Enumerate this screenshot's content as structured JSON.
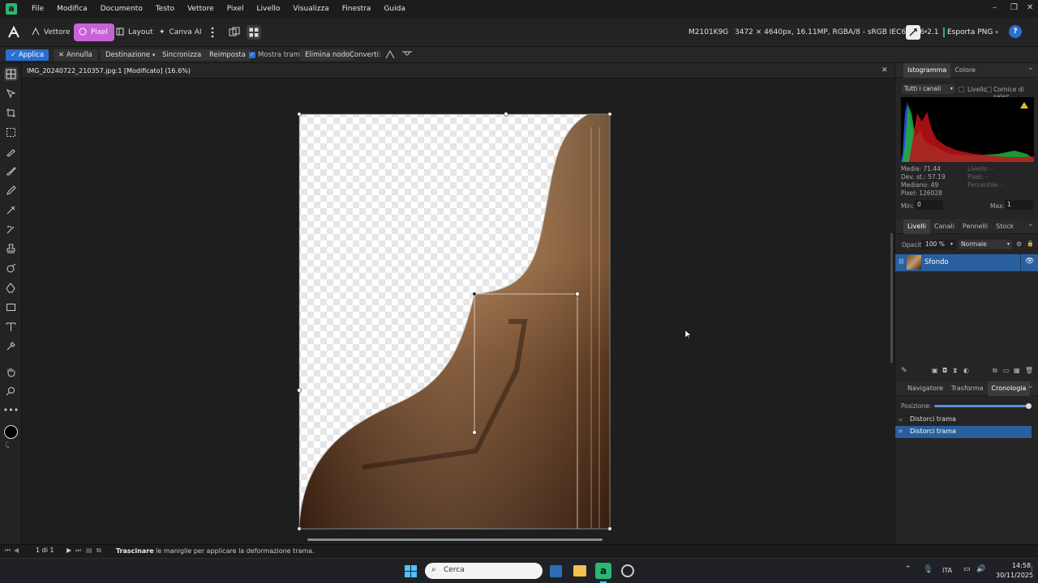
{
  "menubar": {
    "items": [
      "File",
      "Modifica",
      "Documento",
      "Testo",
      "Vettore",
      "Pixel",
      "Livello",
      "Visualizza",
      "Finestra",
      "Guida"
    ]
  },
  "toolbar": {
    "personas": [
      {
        "label": "Vettore"
      },
      {
        "label": "Pixel"
      },
      {
        "label": "Layout"
      },
      {
        "label": "Canva AI"
      }
    ],
    "device": "M2101K9G",
    "doc_info": "3472 × 4640px, 16.11MP, RGBA/8 - sRGB IEC61966-2.1",
    "export_label": "Esporta PNG"
  },
  "contextbar": {
    "apply": "Applica",
    "cancel": "Annulla",
    "destination": "Destinazione",
    "sync": "Sincronizza",
    "reset": "Reimposta",
    "show_mesh": "Mostra trama",
    "delete_node": "Elimina nodo",
    "convert": "Converti:"
  },
  "document": {
    "tab_title": "IMG_20240722_210357.jpg:1 [Modificato] (16.6%)"
  },
  "histogram": {
    "tabs": [
      "Istogramma",
      "Colore"
    ],
    "channel": "Tutti i canali",
    "layer_label": "Livello",
    "selection_label": "Cornice di selez",
    "media": "Media: 71.44",
    "devstd": "Dev. st.: 57.19",
    "mediana": "Mediano: 49",
    "pixel": "Pixel: 126028",
    "livello": "Livello: -",
    "pixel_r": "Pixel: -",
    "percentile": "Percentile: -",
    "min_label": "Min:",
    "min_value": "0",
    "max_label": "Max:",
    "max_value": "1"
  },
  "layers": {
    "tabs": [
      "Livelli",
      "Canali",
      "Pennelli",
      "Stock"
    ],
    "opacity_label": "Opacità:",
    "opacity_value": "100 %",
    "blend_mode": "Normale",
    "layer_name": "Sfondo"
  },
  "history": {
    "tabs": [
      "Navigatore",
      "Trasforma",
      "Cronologia"
    ],
    "position_label": "Posizione:",
    "position_fraction": 1.0,
    "entries": [
      "Distorci trama",
      "Distorci trama"
    ]
  },
  "statusbar": {
    "page": "1 di 1",
    "hint_bold": "Trascinare",
    "hint_rest": " le maniglie per applicare la deformazione trama."
  },
  "taskbar": {
    "search_placeholder": "Cerca",
    "lang": "ITA",
    "time": "14:58",
    "date": "30/11/2025"
  },
  "colors": {
    "accent": "#2a6fd1",
    "persona_active": "#c961d9",
    "selected_row": "#2a5f9e"
  }
}
